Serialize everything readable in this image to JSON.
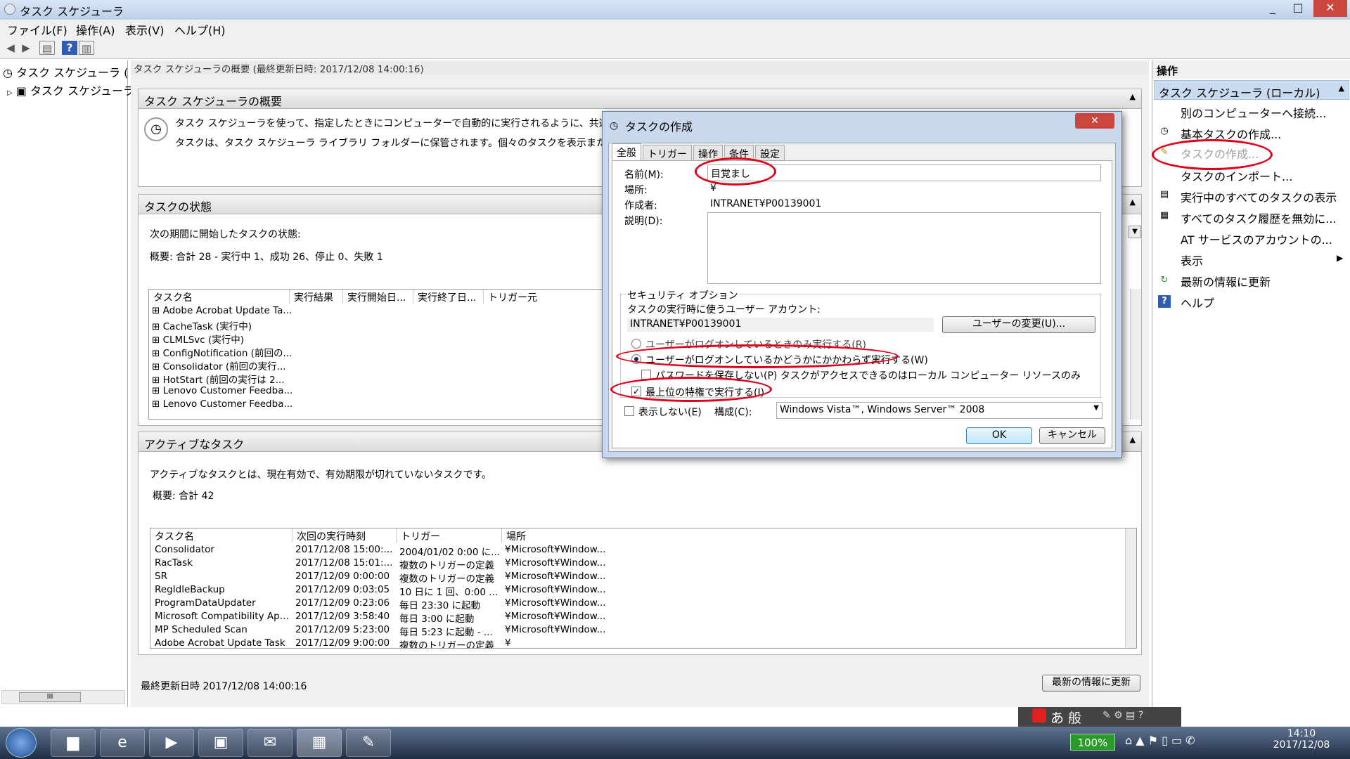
{
  "window": {
    "title": "タスク スケジューラ",
    "controls": [
      "_",
      "□",
      "✕"
    ]
  },
  "menubar": [
    "ファイル(F)",
    "操作(A)",
    "表示(V)",
    "ヘルプ(H)"
  ],
  "tree": {
    "root": "タスク スケジューラ (",
    "child": "タスク スケジューラ"
  },
  "center": {
    "header": "タスク スケジューラの概要 (最終更新日時: 2017/12/08 14:00:16)",
    "overview": {
      "title": "タスク スケジューラの概要",
      "line1": "タスク スケジューラを使って、指定したときにコンピューターで自動的に実行されるように、共通タスクを作成し",
      "line2": "タスクは、タスク スケジューラ ライブラリ フォルダーに保管されます。個々のタスクを表示または操作するには、"
    },
    "status": {
      "title": "タスクの状態",
      "line1": "次の期間に開始したタスクの状態:",
      "summary": "概要: 合計 28 - 実行中 1、成功 26、停止 0、失敗 1",
      "columns": [
        "タスク名",
        "実行結果",
        "実行開始日...",
        "実行終了日...",
        "トリガー元"
      ],
      "rows": [
        "Adobe Acrobat Update Ta...",
        "CacheTask (実行中)",
        "CLMLSvc (実行中)",
        "ConfigNotification (前回の...",
        "Consolidator (前回の実行...",
        "HotStart (前回の実行は 2...",
        "Lenovo Customer Feedba...",
        "Lenovo Customer Feedba..."
      ]
    },
    "active": {
      "title": "アクティブなタスク",
      "line1": "アクティブなタスクとは、現在有効で、有効期限が切れていないタスクです。",
      "summary": "概要: 合計 42",
      "columns": [
        "タスク名",
        "次回の実行時刻",
        "トリガー",
        "場所"
      ],
      "rows": [
        [
          "Consolidator",
          "2017/12/08 15:00:...",
          "2004/01/02 0:00 に...",
          "¥Microsoft¥Window..."
        ],
        [
          "RacTask",
          "2017/12/08 15:01:...",
          "複数のトリガーの定義",
          "¥Microsoft¥Window..."
        ],
        [
          "SR",
          "2017/12/09 0:00:00",
          "複数のトリガーの定義",
          "¥Microsoft¥Window..."
        ],
        [
          "RegIdleBackup",
          "2017/12/09 0:03:05",
          "10 日に 1 回、0:00 ...",
          "¥Microsoft¥Window..."
        ],
        [
          "ProgramDataUpdater",
          "2017/12/09 0:23:06",
          "毎日 23:30 に起動",
          "¥Microsoft¥Window..."
        ],
        [
          "Microsoft Compatibility Appr...",
          "2017/12/09 3:58:40",
          "毎日 3:00 に起動",
          "¥Microsoft¥Window..."
        ],
        [
          "MP Scheduled Scan",
          "2017/12/09 5:23:00",
          "毎日 5:23 に起動 - ...",
          "¥Microsoft¥Window..."
        ],
        [
          "Adobe Acrobat Update Task",
          "2017/12/09 9:00:00",
          "複数のトリガーの定義",
          "¥"
        ]
      ]
    },
    "footer": {
      "last_updated": "最終更新日時 2017/12/08 14:00:16",
      "refresh": "最新の情報に更新"
    }
  },
  "actions": {
    "header": "操作",
    "group": "タスク スケジューラ (ローカル)",
    "items": [
      "別のコンピューターへ接続...",
      "基本タスクの作成...",
      "タスクの作成...",
      "タスクのインポート...",
      "実行中のすべてのタスクの表示",
      "すべてのタスク履歴を無効に...",
      "AT サービスのアカウントの...",
      "表示",
      "最新の情報に更新",
      "ヘルプ"
    ]
  },
  "dialog": {
    "title": "タスクの作成",
    "close": "✕",
    "tabs": [
      "全般",
      "トリガー",
      "操作",
      "条件",
      "設定"
    ],
    "name_label": "名前(M):",
    "name_value": "目覚まし",
    "location_label": "場所:",
    "location_value": "¥",
    "author_label": "作成者:",
    "author_value": "INTRANET¥P00139001",
    "desc_label": "説明(D):",
    "security_group": "セキュリティ オプション",
    "account_label": "タスクの実行時に使うユーザー アカウント:",
    "account_value": "INTRANET¥P00139001",
    "change_user": "ユーザーの変更(U)...",
    "radio1": "ユーザーがログオンしているときのみ実行する(R)",
    "radio2": "ユーザーがログオンしているかどうかにかかわらず実行する(W)",
    "no_password": "パスワードを保存しない(P)  タスクがアクセスできるのはローカル コンピューター リソースのみ",
    "highest": "最上位の特権で実行する(I)",
    "hidden": "表示しない(E)",
    "config_label": "構成(C):",
    "config_value": "Windows Vista™, Windows Server™ 2008",
    "ok": "OK",
    "cancel": "キャンセル"
  },
  "ime": {
    "text": "あ 般"
  },
  "tray": {
    "battery": "100%",
    "time": "14:10",
    "date": "2017/12/08"
  }
}
